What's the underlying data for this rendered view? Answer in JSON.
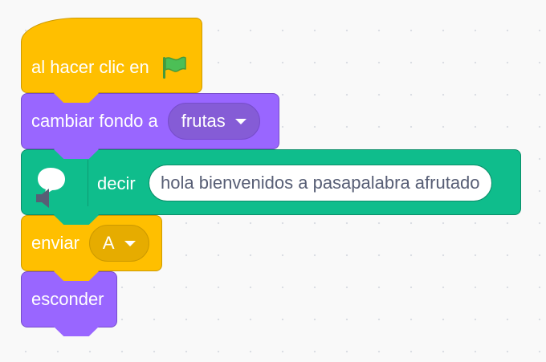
{
  "blocks": {
    "when_flag": {
      "label": "al hacer clic en",
      "icon": "green-flag-icon",
      "color": "#FFBF00"
    },
    "switch_backdrop": {
      "label": "cambiar fondo a",
      "value": "frutas",
      "color": "#9966FF"
    },
    "say": {
      "label": "decir",
      "message": "hola bienvenidos a pasapalabra afrutado",
      "icon": "speech-bubble-icon",
      "color": "#0FBD8C"
    },
    "broadcast": {
      "label": "enviar",
      "value": "A",
      "color": "#FFBF00"
    },
    "hide": {
      "label": "esconder",
      "color": "#9966FF"
    }
  }
}
